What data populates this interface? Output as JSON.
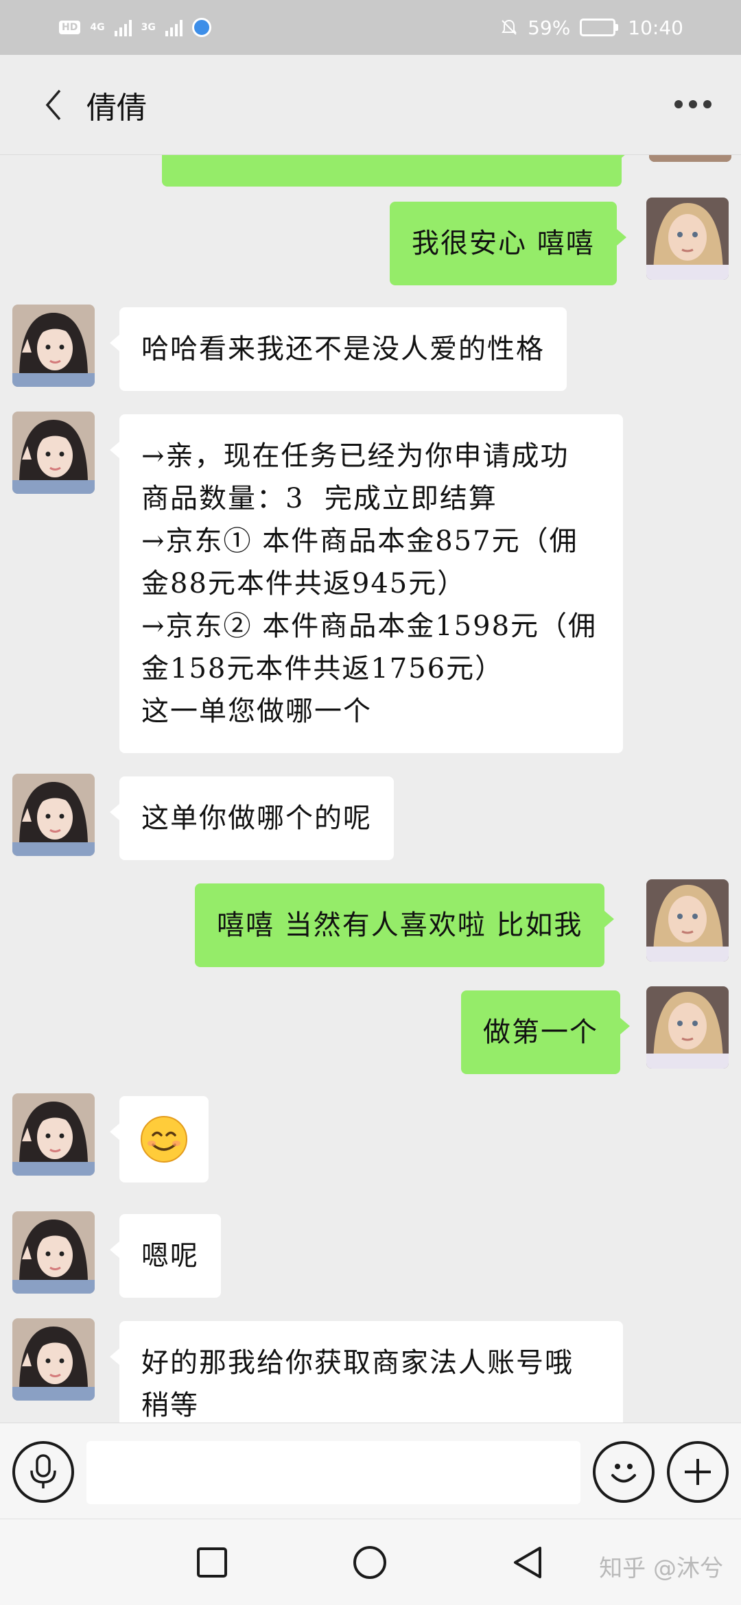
{
  "status_bar": {
    "hd_label": "HD",
    "network_1": "4G",
    "network_2": "3G",
    "battery_percent": "59%",
    "battery_level": 0.59,
    "time": "10:40"
  },
  "header": {
    "title": "倩倩",
    "back_icon": "chevron-left-icon",
    "more_icon": "more-dots-icon"
  },
  "messages": [
    {
      "side": "out",
      "lines": [
        ""
      ],
      "partial": true
    },
    {
      "side": "out",
      "lines": [
        "我很安心 嘻嘻"
      ]
    },
    {
      "side": "in",
      "lines": [
        "哈哈看来我还不是没人爱的性格"
      ]
    },
    {
      "side": "in",
      "lines": [
        "→亲，现在任务已经为你申请成功",
        "商品数量：3  完成立即结算",
        "→京东① 本件商品本金857元（佣",
        "金88元本件共返945元）",
        "→京东② 本件商品本金1598元（佣",
        "金158元本件共返1756元）",
        "这一单您做哪一个"
      ]
    },
    {
      "side": "in",
      "lines": [
        "这单你做哪个的呢"
      ]
    },
    {
      "side": "out",
      "lines": [
        "嘻嘻 当然有人喜欢啦 比如我"
      ]
    },
    {
      "side": "out",
      "lines": [
        "做第一个"
      ]
    },
    {
      "side": "in",
      "lines": [
        "😊"
      ]
    },
    {
      "side": "in",
      "lines": [
        "嗯呢"
      ]
    },
    {
      "side": "in",
      "lines": [
        "好的那我给你获取商家法人账号哦",
        "稍等"
      ]
    }
  ],
  "input_bar": {
    "voice_icon": "microphone-icon",
    "input_value": "",
    "emoji_icon": "smiley-icon",
    "plus_icon": "plus-icon"
  },
  "nav_bar": {
    "recents_icon": "square-icon",
    "home_icon": "circle-icon",
    "back_icon": "triangle-back-icon",
    "watermark": "知乎 @沐兮"
  },
  "colors": {
    "out_bubble": "#95ec69",
    "in_bubble": "#ffffff",
    "chat_bg": "#ededed"
  }
}
